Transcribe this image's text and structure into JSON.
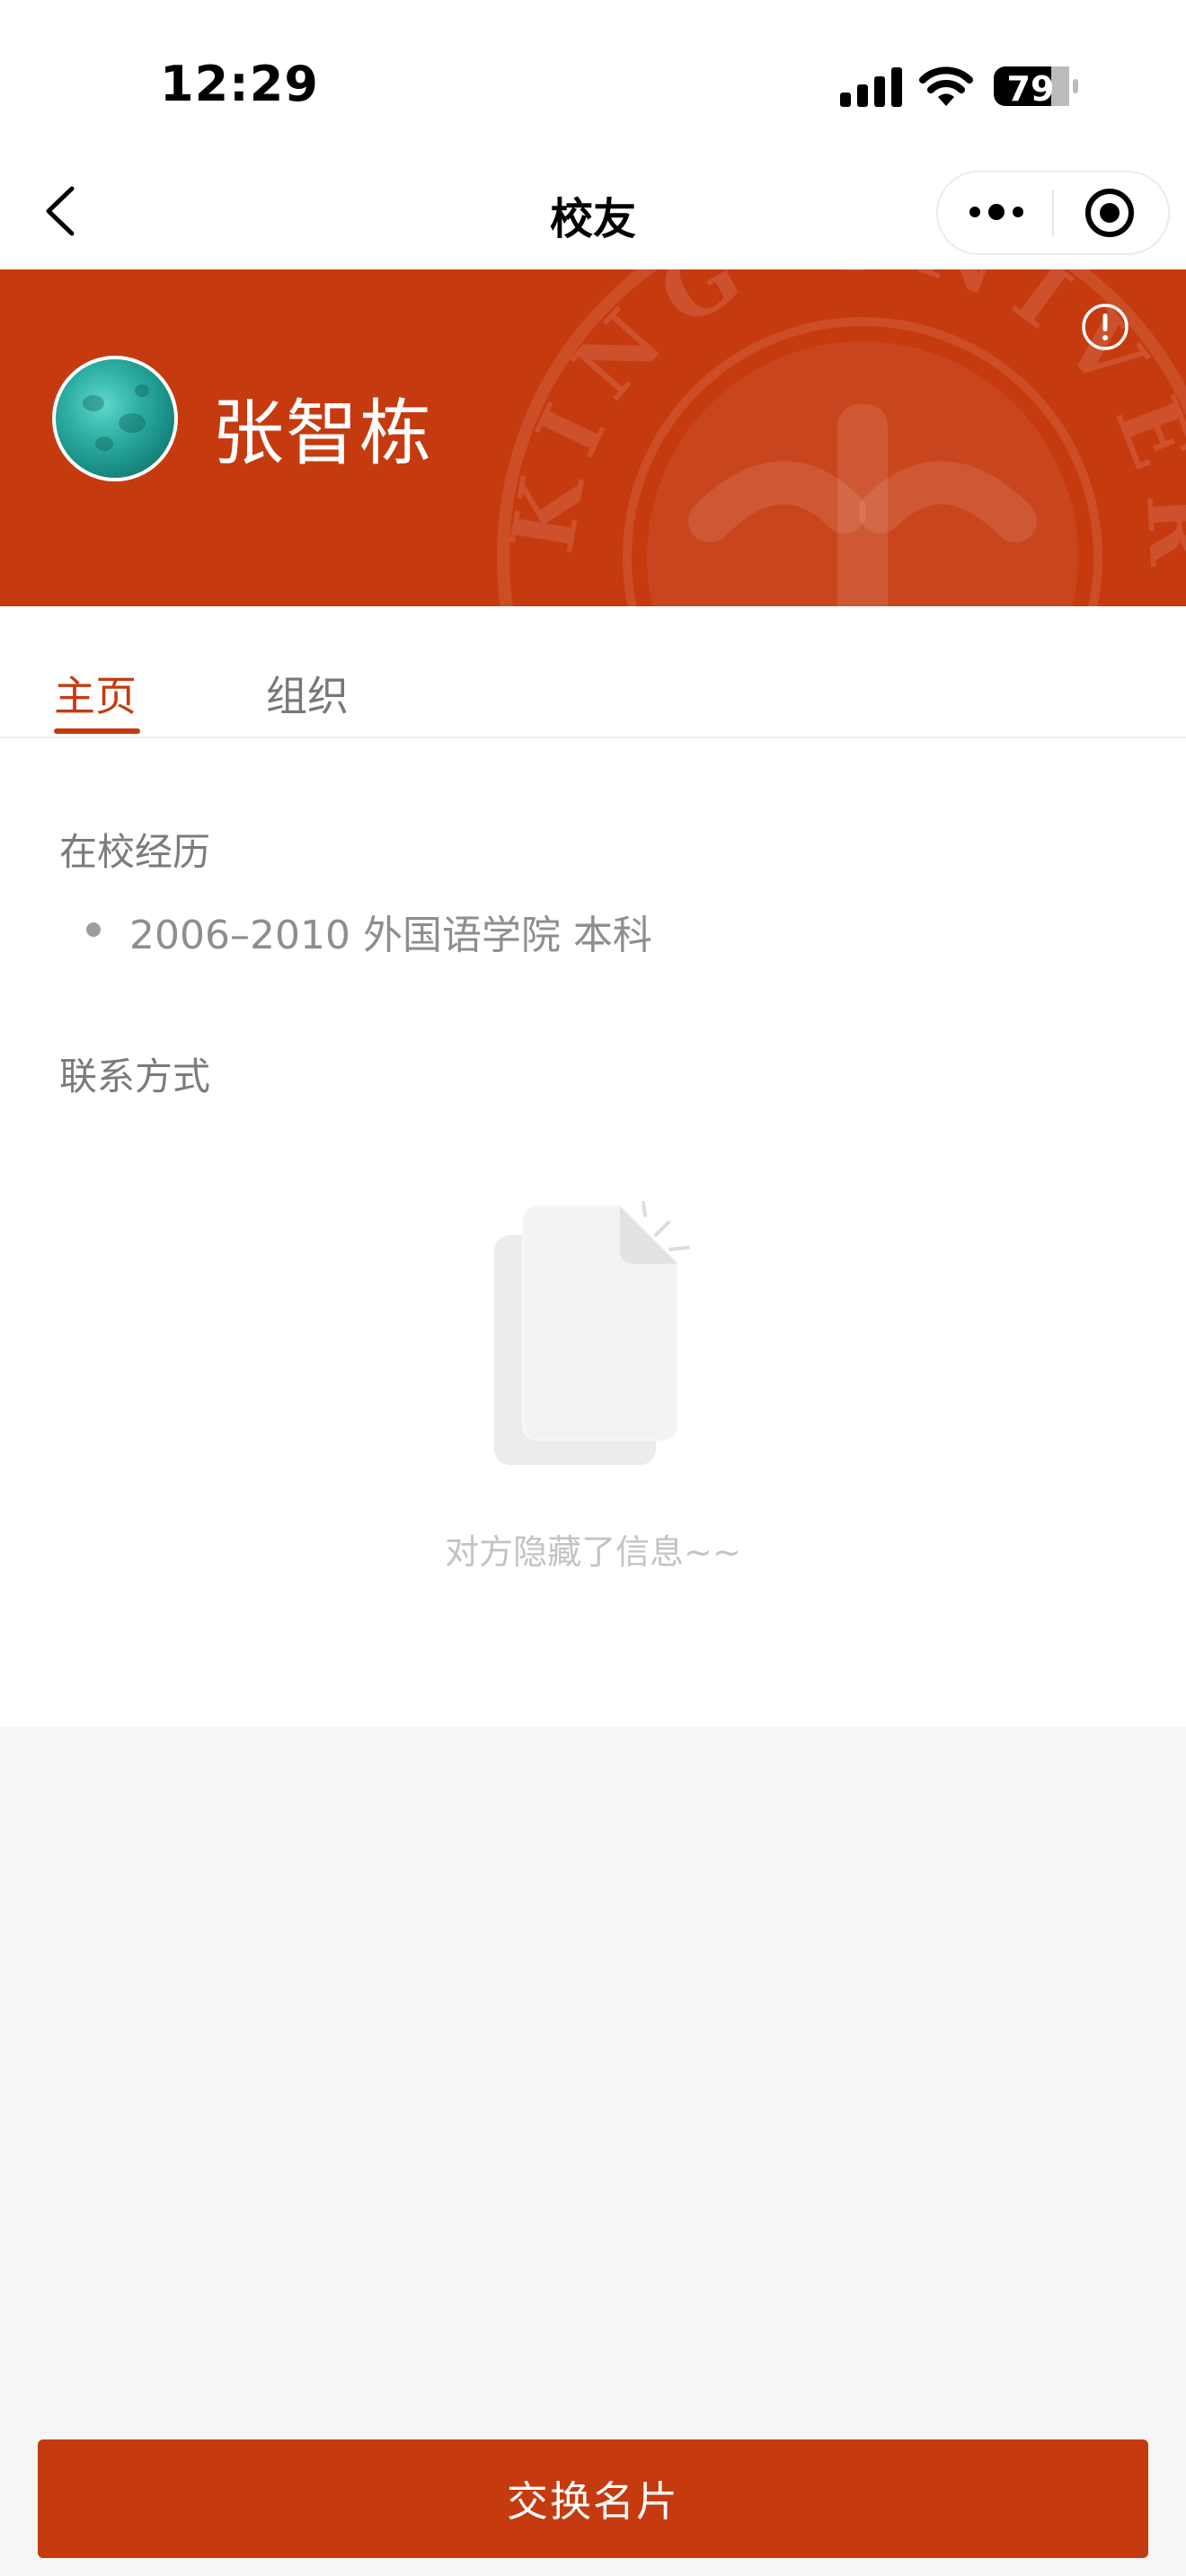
{
  "status_bar": {
    "time": "12:29",
    "battery_level": "79",
    "icons": [
      "signal-icon",
      "wifi-icon",
      "battery-icon"
    ]
  },
  "nav": {
    "title": "校友",
    "icons": [
      "back-icon",
      "more-icon",
      "target-icon"
    ]
  },
  "profile": {
    "name": "张智栋",
    "banner_color": "#c63a0f",
    "watermark_text": "KING UNIVER",
    "icons": [
      "avatar",
      "info-icon"
    ]
  },
  "tabs": [
    {
      "label": "主页",
      "active": true
    },
    {
      "label": "组织",
      "active": false
    }
  ],
  "education": {
    "title": "在校经历",
    "items": [
      "2006–2010 外国语学院 本科"
    ]
  },
  "contact": {
    "title": "联系方式",
    "empty_message": "对方隐藏了信息~~",
    "icons": [
      "empty-document-icon"
    ]
  },
  "footer": {
    "button_label": "交换名片",
    "accent_color": "#c63a0f"
  }
}
